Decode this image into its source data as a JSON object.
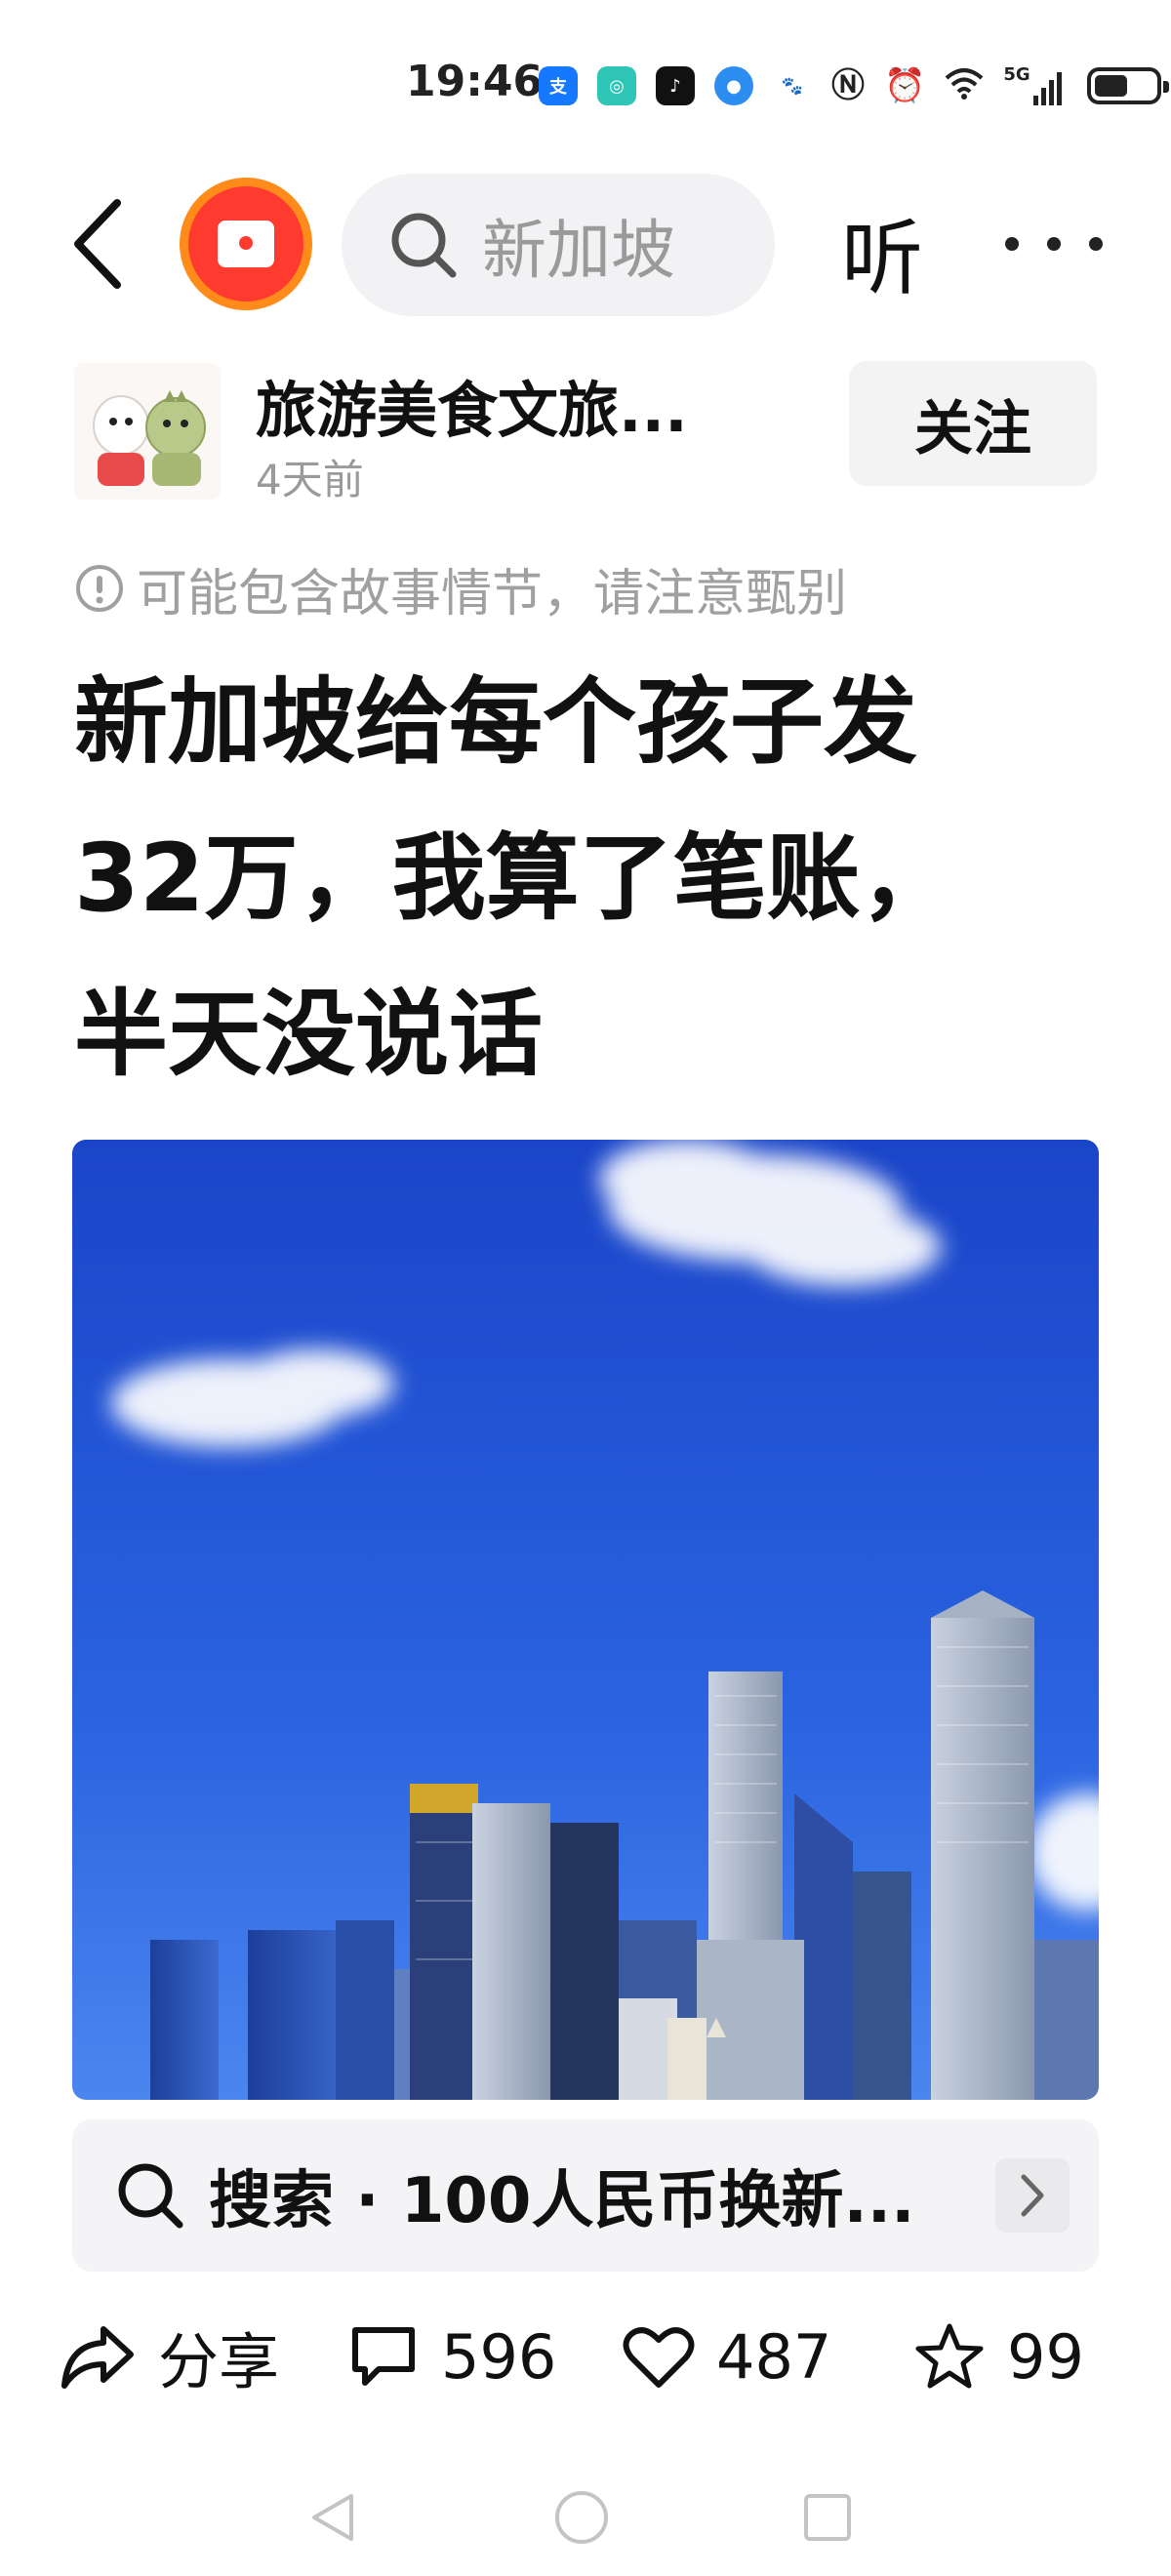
{
  "status_bar": {
    "time": "19:46",
    "network_label": "5G",
    "app_icons": [
      "alipay-icon",
      "app-icon",
      "tiktok-icon",
      "browser-icon",
      "baidu-icon"
    ],
    "system_icons": [
      "nfc-icon",
      "alarm-icon",
      "wifi-icon",
      "signal-icon",
      "battery-icon"
    ],
    "battery_level": 0.55
  },
  "top_nav": {
    "search_placeholder": "新加坡",
    "listen_label": "听"
  },
  "author": {
    "name": "旅游美食文旅...",
    "time": "4天前",
    "follow_label": "关注"
  },
  "notice": "可能包含故事情节，请注意甄别",
  "article": {
    "title_lines": [
      "新加坡给每个孩子发",
      "32万，我算了笔账，",
      "半天没说话"
    ]
  },
  "related_search": {
    "text": "搜索 · 100人民币换新..."
  },
  "actions": {
    "share_label": "分享",
    "comments_count": "596",
    "likes_count": "487",
    "favorites_count": "99"
  },
  "colors": {
    "accent_orange": "#ff8c1a",
    "redpack_red": "#ff3b30",
    "muted_text": "#9a9a9a",
    "sky_blue": "#1e4fd6"
  }
}
